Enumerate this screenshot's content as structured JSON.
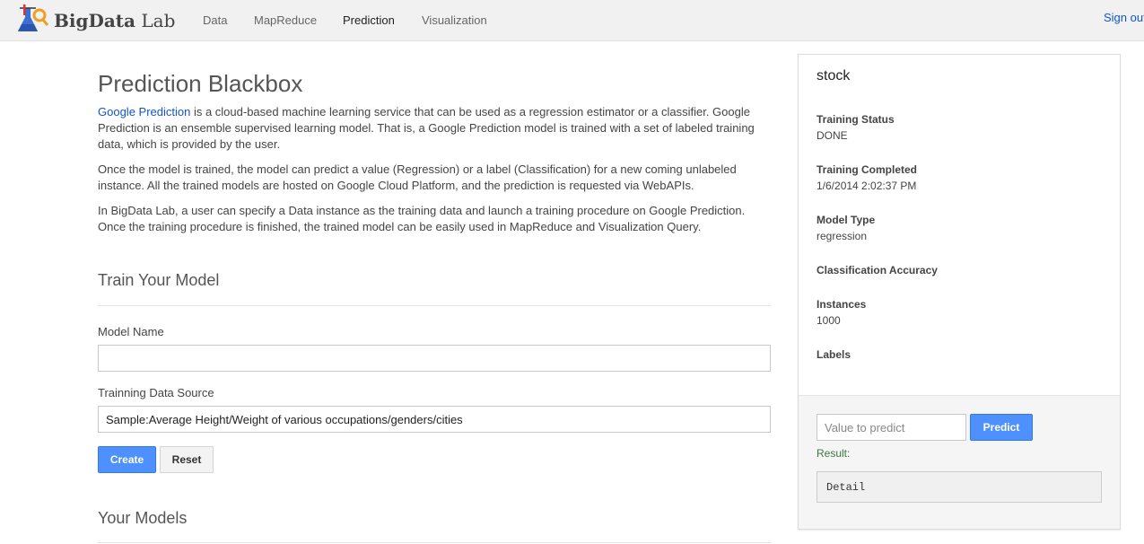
{
  "header": {
    "brand_bold": "BigData",
    "brand_rest": " Lab",
    "nav": [
      "Data",
      "MapReduce",
      "Prediction",
      "Visualization"
    ],
    "active": "Prediction",
    "signout": "Sign out"
  },
  "main": {
    "title": "Prediction Blackbox",
    "intro_link": "Google Prediction",
    "intro_rest": " is a cloud-based machine learning service that can be used as a regression estimator or a classifier. Google Prediction is an ensemble supervised learning model. That is, a Google Prediction model is trained with a set of labeled training data, which is provided by the user.",
    "para2": "Once the model is trained, the model can predict a value (Regression) or a label (Classification) for a new coming unlabeled instance. All the trained models are hosted on Google Cloud Platform, and the prediction is requested via WebAPIs.",
    "para3": "In BigData Lab, a user can specify a Data instance as the training data and launch a training procedure on Google Prediction. Once the training procedure is finished, the trained model can be easily used in MapReduce and Visualization Query.",
    "train_title": "Train Your Model",
    "model_name_label": "Model Name",
    "model_name_value": "",
    "data_source_label": "Trainning Data Source",
    "data_source_value": "Sample:Average Height/Weight of various occupations/genders/cities",
    "create_label": "Create",
    "reset_label": "Reset",
    "your_models_title": "Your Models"
  },
  "panel": {
    "title": "stock",
    "fields": [
      {
        "label": "Training Status",
        "value": "DONE"
      },
      {
        "label": "Training Completed",
        "value": "1/6/2014 2:02:37 PM"
      },
      {
        "label": "Model Type",
        "value": "regression"
      },
      {
        "label": "Classification Accuracy",
        "value": ""
      },
      {
        "label": "Instances",
        "value": "1000"
      },
      {
        "label": "Labels",
        "value": ""
      }
    ],
    "predict_placeholder": "Value to predict",
    "predict_label": "Predict",
    "result_label": "Result:",
    "detail": "Detail"
  },
  "colors": {
    "accent": "#4d90fe",
    "link": "#1155cc",
    "result": "#3c763d"
  }
}
